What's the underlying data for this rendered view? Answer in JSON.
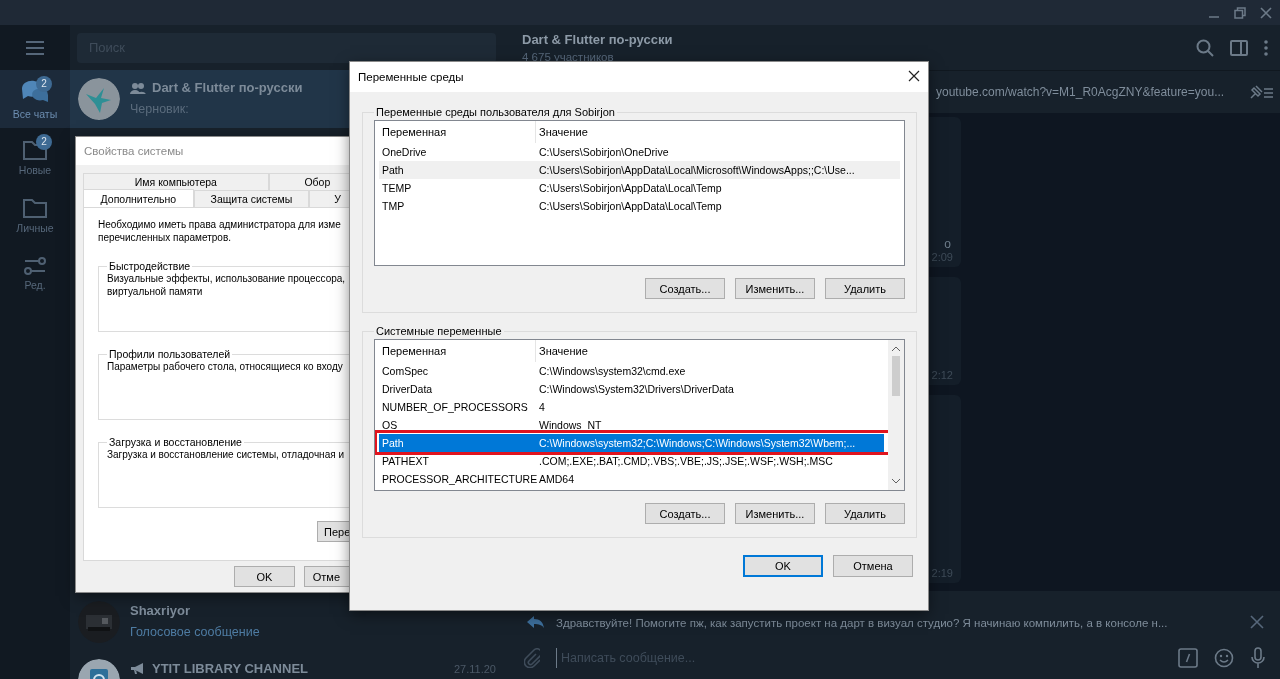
{
  "folders": [
    {
      "kind": "chats",
      "label": "Все чаты",
      "badge": "2",
      "selected": true
    },
    {
      "kind": "folder",
      "label": "Новые",
      "badge": "2",
      "selected": false
    },
    {
      "kind": "folder",
      "label": "Личные",
      "selected": false
    },
    {
      "kind": "edit",
      "label": "Ред.",
      "selected": false
    }
  ],
  "search": {
    "placeholder": "Поиск"
  },
  "chats": [
    {
      "kind": "group",
      "name": "Dart & Flutter по-русски",
      "preview": "Черновик:",
      "selected": true
    },
    {
      "kind": "user",
      "name": "Shaxriyor",
      "preview": "Голосовое сообщение",
      "selected": false
    },
    {
      "kind": "channel",
      "name": "YTIT LIBRARY CHANNEL",
      "date": "27.11.20",
      "selected": false
    }
  ],
  "chat_header": {
    "title": "Dart & Flutter по-русски",
    "subtitle": "4 675 участников"
  },
  "pinned": {
    "text": "youtube.com/watch?v=M1_R0AcgZNY&feature=you..."
  },
  "messages": [
    {
      "text": "о",
      "time": "2:09"
    },
    {
      "time": "2:12"
    },
    {
      "time": "2:19"
    }
  ],
  "reply": {
    "text": "Здравствуйте! Помогите пж, как запустить проект на дарт в визуал студио? Я начинаю компилить, а в консоле н..."
  },
  "composer": {
    "placeholder": "Написать сообщение..."
  },
  "system_properties": {
    "title": "Свойства системы",
    "tab_rows": [
      [
        {
          "label": "Имя компьютера",
          "selected": false
        },
        {
          "label": "Обор",
          "selected": false
        }
      ],
      [
        {
          "label": "Дополнительно",
          "selected": true
        },
        {
          "label": "Защита системы",
          "selected": false
        },
        {
          "label": "У",
          "selected": false
        }
      ]
    ],
    "notice_lines": [
      "Необходимо иметь права администратора для изме",
      "перечисленных параметров."
    ],
    "groups": [
      {
        "title": "Быстродействие",
        "lines": [
          "Визуальные эффекты, использование процессора,",
          "виртуальной памяти"
        ]
      },
      {
        "title": "Профили пользователей",
        "lines": [
          "Параметры рабочего стола, относящиеся ко входу"
        ]
      },
      {
        "title": "Загрузка и восстановление",
        "lines": [
          "Загрузка и восстановление системы, отладочная и"
        ]
      }
    ],
    "panel_button": "Пере",
    "buttons": [
      "OK",
      "Отме"
    ]
  },
  "environment_variables": {
    "title": "Переменные среды",
    "user_group": {
      "title": "Переменные среды пользователя для Sobirjon",
      "columns": [
        "Переменная",
        "Значение"
      ],
      "rows": [
        {
          "name": "OneDrive",
          "value": "C:\\Users\\Sobirjon\\OneDrive",
          "selected": false,
          "hovered": false,
          "highlighted": false
        },
        {
          "name": "Path",
          "value": "C:\\Users\\Sobirjon\\AppData\\Local\\Microsoft\\WindowsApps;;C:\\Use...",
          "selected": false,
          "hovered": true,
          "highlighted": false
        },
        {
          "name": "TEMP",
          "value": "C:\\Users\\Sobirjon\\AppData\\Local\\Temp",
          "selected": false,
          "hovered": false,
          "highlighted": false
        },
        {
          "name": "TMP",
          "value": "C:\\Users\\Sobirjon\\AppData\\Local\\Temp",
          "selected": false,
          "hovered": false,
          "highlighted": false
        }
      ],
      "buttons": [
        "Создать...",
        "Изменить...",
        "Удалить"
      ]
    },
    "system_group": {
      "title": "Системные переменные",
      "columns": [
        "Переменная",
        "Значение"
      ],
      "rows": [
        {
          "name": "ComSpec",
          "value": "C:\\Windows\\system32\\cmd.exe",
          "selected": false,
          "hovered": false,
          "highlighted": false
        },
        {
          "name": "DriverData",
          "value": "C:\\Windows\\System32\\Drivers\\DriverData",
          "selected": false,
          "hovered": false,
          "highlighted": false
        },
        {
          "name": "NUMBER_OF_PROCESSORS",
          "value": "4",
          "selected": false,
          "hovered": false,
          "highlighted": false
        },
        {
          "name": "OS",
          "value": "Windows_NT",
          "selected": false,
          "hovered": false,
          "highlighted": false
        },
        {
          "name": "Path",
          "value": "C:\\Windows\\system32;C:\\Windows;C:\\Windows\\System32\\Wbem;...",
          "selected": true,
          "hovered": false,
          "highlighted": true
        },
        {
          "name": "PATHEXT",
          "value": ".COM;.EXE;.BAT;.CMD;.VBS;.VBE;.JS;.JSE;.WSF;.WSH;.MSC",
          "selected": false,
          "hovered": false,
          "highlighted": false
        },
        {
          "name": "PROCESSOR_ARCHITECTURE",
          "value": "AMD64",
          "selected": false,
          "hovered": false,
          "highlighted": false
        }
      ],
      "buttons": [
        "Создать...",
        "Изменить...",
        "Удалить"
      ]
    },
    "buttons": [
      {
        "label": "OK",
        "focused": true
      },
      {
        "label": "Отмена",
        "focused": false
      }
    ]
  }
}
